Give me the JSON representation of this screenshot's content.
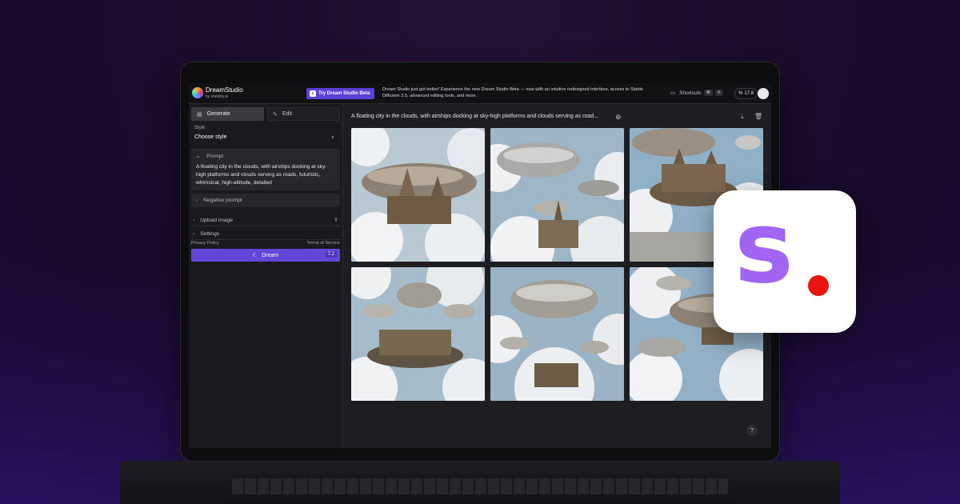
{
  "app": {
    "name": "DreamStudio",
    "by": "by stability.ai"
  },
  "topbar": {
    "beta_button": "Try Dream Studio Beta",
    "beta_icon": "dream-studio-beta-icon",
    "announcement": "Dream Studio just got better! Experience the new Dream Studio Beta — now with an intuitive redesigned interface, access to Stable Diffusion 3.5, advanced editing tools, and more.",
    "shortcuts_label": "Shortcuts",
    "shortcut_keys": [
      "⌘",
      "K"
    ],
    "credits": "17.8"
  },
  "sidebar": {
    "modes": [
      {
        "label": "Generate",
        "icon": "generate-icon",
        "active": true
      },
      {
        "label": "Edit",
        "icon": "edit-icon",
        "active": false
      }
    ],
    "style_label": "Style",
    "style_value": "Choose style",
    "prompt_header": "Prompt",
    "prompt_text": "A floating city in the clouds, with airships docking at sky-high platforms and clouds serving as roads, futuristic, whimsical, high-altitude, detailed",
    "negative_prompt": "Negative prompt",
    "upload_image": "Upload image",
    "settings": "Settings",
    "privacy_policy": "Privacy Policy",
    "terms": "Terms of Service",
    "dream_button": "Dream",
    "dream_cost": "7.2"
  },
  "main": {
    "title": "A floating city in the clouds, with airships docking at sky-high platforms and clouds serving as road...",
    "image_count": 6,
    "help": "?"
  },
  "brand_card": {
    "letter": "s",
    "letter_color": "#a264f2",
    "dot_color": "#e9150f"
  },
  "colors": {
    "accent": "#6446d8",
    "background": "#170a2c"
  }
}
